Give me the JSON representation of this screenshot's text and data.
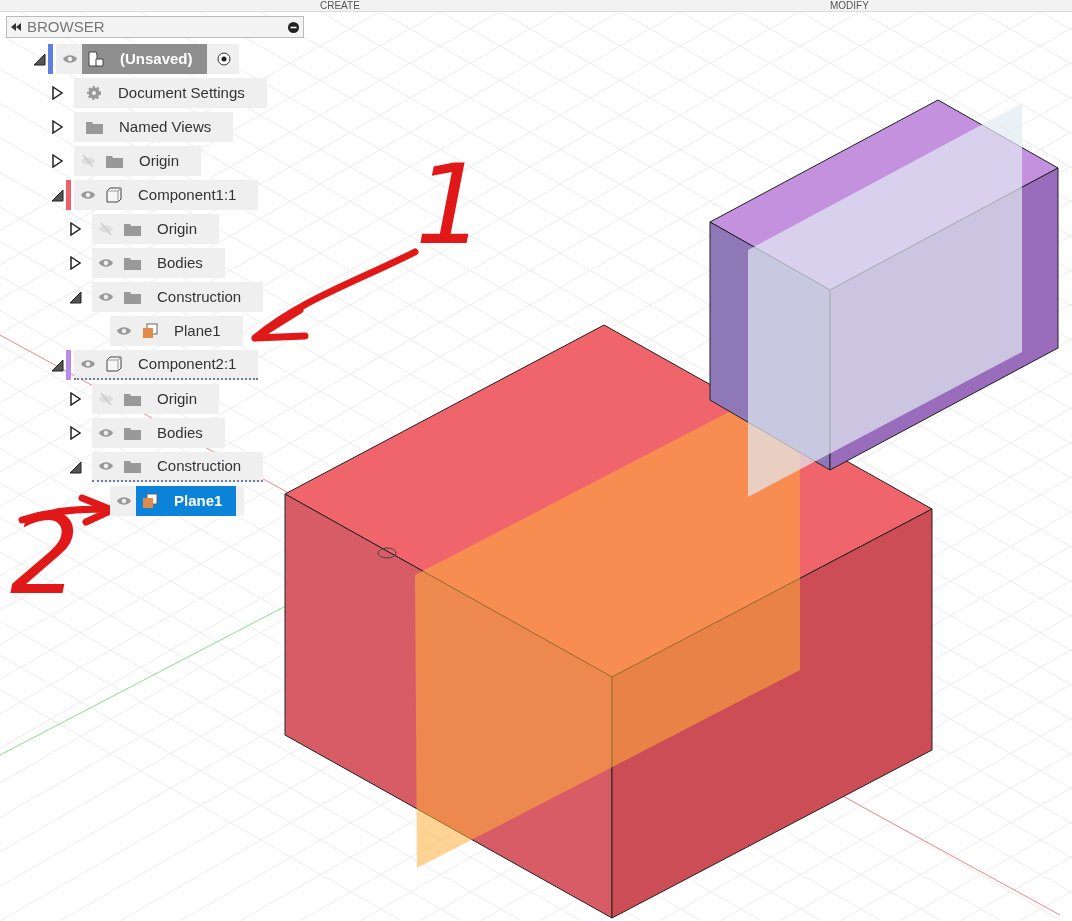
{
  "toolbar": {
    "labels": [
      "CREATE",
      "MODIFY"
    ]
  },
  "browser": {
    "title": "BROWSER",
    "tree": [
      {
        "label": "(Unsaved)",
        "kind": "document",
        "expanded": true,
        "visible": true,
        "color": "#5b80e0",
        "selected": false,
        "dotted": false,
        "activate_marker": true,
        "children": [
          {
            "label": "Document Settings",
            "kind": "settings",
            "expanded": false,
            "selected": false,
            "dotted": false
          },
          {
            "label": "Named Views",
            "kind": "folder",
            "expanded": false,
            "selected": false,
            "dotted": false
          },
          {
            "label": "Origin",
            "kind": "folder",
            "expanded": false,
            "visible": false,
            "selected": false,
            "dotted": false
          },
          {
            "label": "Component1:1",
            "kind": "component",
            "expanded": true,
            "visible": true,
            "color": "#f0606c",
            "selected": false,
            "dotted": false,
            "children": [
              {
                "label": "Origin",
                "kind": "folder",
                "expanded": false,
                "visible": false,
                "selected": false,
                "dotted": false
              },
              {
                "label": "Bodies",
                "kind": "folder",
                "expanded": false,
                "visible": true,
                "selected": false,
                "dotted": false
              },
              {
                "label": "Construction",
                "kind": "folder",
                "expanded": true,
                "visible": true,
                "selected": false,
                "dotted": false,
                "children": [
                  {
                    "label": "Plane1",
                    "kind": "plane",
                    "visible": true,
                    "selected": false,
                    "dotted": false
                  }
                ]
              }
            ]
          },
          {
            "label": "Component2:1",
            "kind": "component",
            "expanded": true,
            "visible": true,
            "color": "#b98be8",
            "selected": false,
            "dotted": true,
            "children": [
              {
                "label": "Origin",
                "kind": "folder",
                "expanded": false,
                "visible": false,
                "selected": false,
                "dotted": false
              },
              {
                "label": "Bodies",
                "kind": "folder",
                "expanded": false,
                "visible": true,
                "selected": false,
                "dotted": false
              },
              {
                "label": "Construction",
                "kind": "folder",
                "expanded": true,
                "visible": true,
                "selected": false,
                "dotted": true,
                "children": [
                  {
                    "label": "Plane1",
                    "kind": "plane",
                    "visible": true,
                    "selected": true,
                    "dotted": false
                  }
                ]
              }
            ]
          }
        ]
      }
    ]
  },
  "annotations": [
    {
      "text": "1"
    },
    {
      "text": "2"
    }
  ]
}
